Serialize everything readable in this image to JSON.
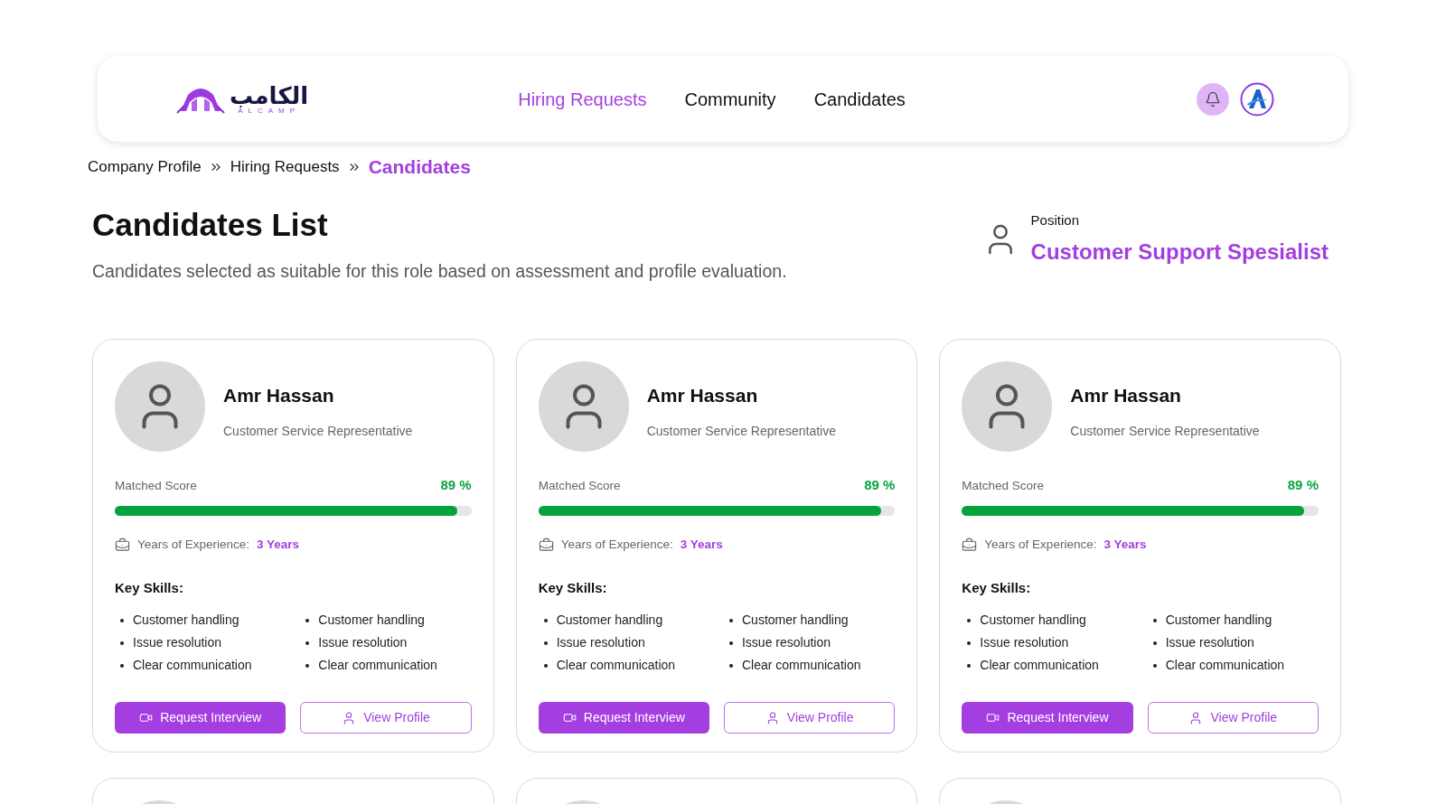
{
  "logo": {
    "arabic": "الكامب",
    "latin": "ALCAMP"
  },
  "nav": [
    {
      "label": "Hiring Requests",
      "selected": true
    },
    {
      "label": "Community",
      "selected": false
    },
    {
      "label": "Candidates",
      "selected": false
    }
  ],
  "breadcrumbs": [
    {
      "label": "Company Profile",
      "selected": false
    },
    {
      "label": "Hiring Requests",
      "selected": false
    },
    {
      "label": "Candidates",
      "selected": true
    }
  ],
  "heading": {
    "title": "Candidates List",
    "subtitle": "Candidates selected as suitable for this role based on assessment and profile evaluation."
  },
  "position": {
    "label": "Position",
    "value": "Customer Support Spesialist"
  },
  "candidates": [
    {
      "kind": "full",
      "name": "Amr Hassan",
      "role": "Customer Service Representative",
      "score_label": "Matched Score",
      "score": "89 %",
      "level": 0.96,
      "experience_label": "Years of Experience:",
      "experience": "3 Years",
      "skills_title": "Key Skills:",
      "skills": [
        "Customer handling",
        "Issue resolution",
        "Clear communication",
        "Customer handling",
        "Issue resolution",
        "Clear communication"
      ],
      "buttons": [
        "Request Interview",
        "View Profile"
      ]
    },
    {
      "kind": "full",
      "name": "Amr Hassan",
      "role": "Customer Service Representative",
      "score_label": "Matched Score",
      "score": "89 %",
      "level": 0.96,
      "experience_label": "Years of Experience:",
      "experience": "3 Years",
      "skills_title": "Key Skills:",
      "skills": [
        "Customer handling",
        "Issue resolution",
        "Clear communication",
        "Customer handling",
        "Issue resolution",
        "Clear communication"
      ],
      "buttons": [
        "Request Interview",
        "View Profile"
      ]
    },
    {
      "kind": "full",
      "name": "Amr Hassan",
      "role": "Customer Service Representative",
      "score_label": "Matched Score",
      "score": "89 %",
      "level": 0.96,
      "experience_label": "Years of Experience:",
      "experience": "3 Years",
      "skills_title": "Key Skills:",
      "skills": [
        "Customer handling",
        "Issue resolution",
        "Clear communication",
        "Customer handling",
        "Issue resolution",
        "Clear communication"
      ],
      "buttons": [
        "Request Interview",
        "View Profile"
      ]
    },
    {
      "kind": "partial"
    },
    {
      "kind": "partial"
    },
    {
      "kind": "partial"
    }
  ]
}
